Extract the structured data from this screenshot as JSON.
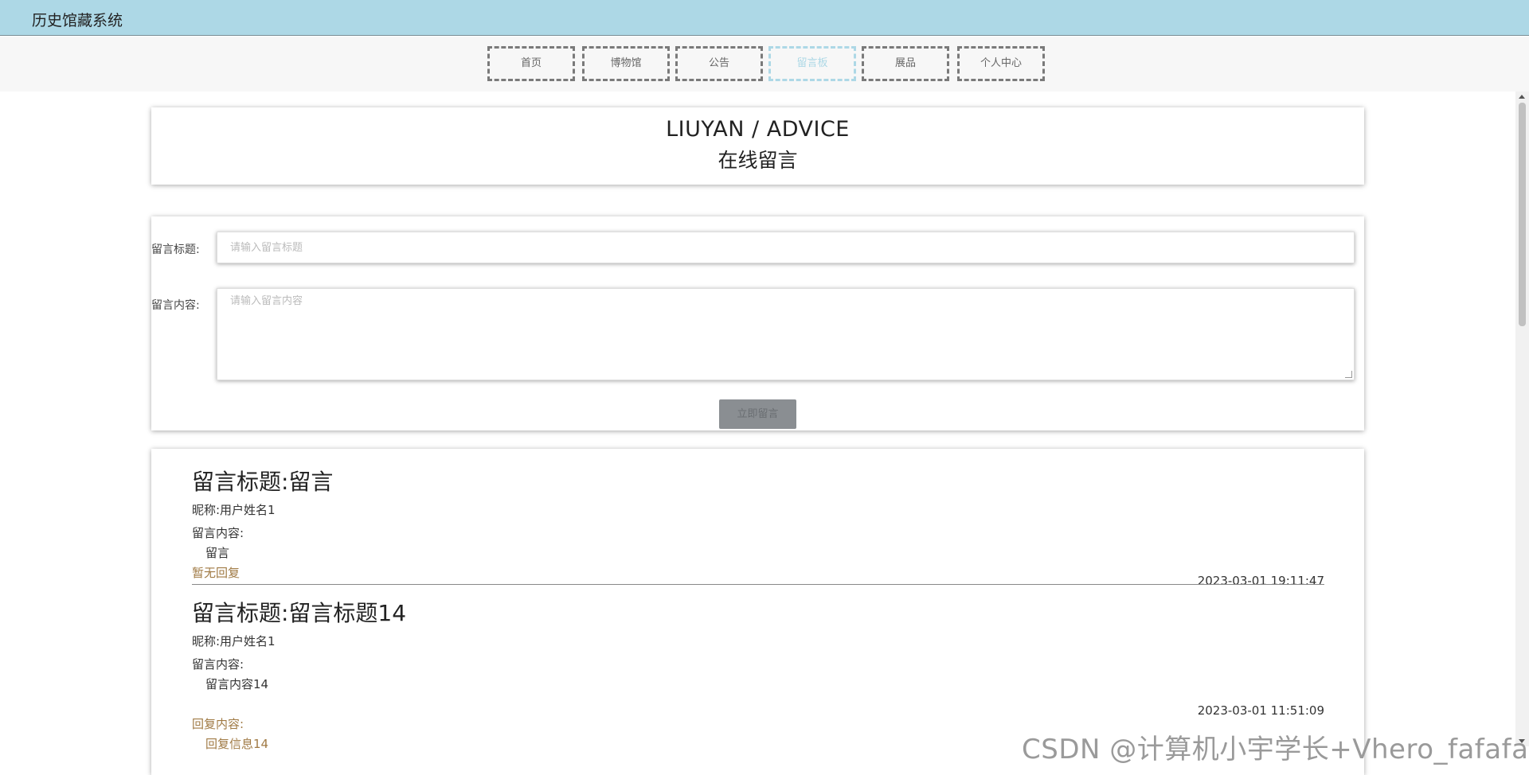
{
  "app": {
    "title": "历史馆藏系统"
  },
  "nav": {
    "items": [
      {
        "label": "首页"
      },
      {
        "label": "博物馆"
      },
      {
        "label": "公告"
      },
      {
        "label": "留言板"
      },
      {
        "label": "展品"
      },
      {
        "label": "个人中心"
      }
    ],
    "active": "留言板"
  },
  "header": {
    "en_title": "LIUYAN / ADVICE",
    "zh_title": "在线留言"
  },
  "form": {
    "title_label": "留言标题:",
    "title_placeholder": "请输入留言标题",
    "content_label": "留言内容:",
    "content_placeholder": "请输入留言内容",
    "submit_label": "立即留言"
  },
  "messages": [
    {
      "title": "留言标题:留言",
      "nickname": "昵称:用户姓名1",
      "content_label": "留言内容:",
      "content": "留言",
      "reply_status": "暂无回复",
      "time": "2023-03-01 19:11:47"
    },
    {
      "title": "留言标题:留言标题14",
      "nickname": "昵称:用户姓名1",
      "content_label": "留言内容:",
      "content": "留言内容14",
      "time": "2023-03-01 11:51:09",
      "reply_label": "回复内容:",
      "reply": "回复信息14"
    }
  ],
  "watermark": "CSDN @计算机小宇学长+Vhero_fafafa",
  "colors": {
    "topbar": "#add8e6",
    "active_nav": "#add8e6",
    "reply_text": "#a07a44",
    "submit_bg": "#8a8e92"
  }
}
